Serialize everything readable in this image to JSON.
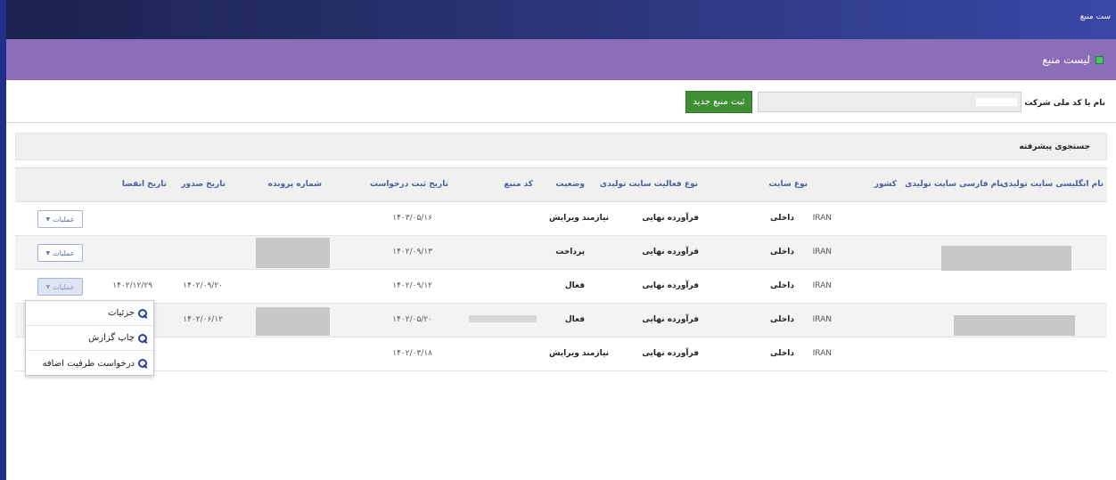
{
  "header": {
    "breadcrumb": "ست منبع"
  },
  "title_bar": {
    "title": "لیست منبع",
    "colors": {
      "title_bg": "#8c6db8",
      "top_bg": "#1b2250"
    }
  },
  "search": {
    "label": "نام یا کد ملی شرکت",
    "value": "",
    "placeholder": ""
  },
  "toolbar": {
    "new_button": "ثبت منبع جدید",
    "new_button_color": "#3f8f35"
  },
  "advanced_search": {
    "label": "جستجوی پیشرفته"
  },
  "table": {
    "columns": [
      "نام انگلیسی سایت تولیدی",
      "نام فارسی سایت تولیدی",
      "کشور",
      "نوع سایت",
      "نوع فعالیت سایت تولیدی",
      "وضعیت",
      "کد منبع",
      "تاریخ ثبت درخواست",
      "شماره پرونده",
      "تاریخ صدور",
      "تاریخ انقضا"
    ],
    "rows": [
      {
        "country": "IRAN",
        "site_type": "داخلی",
        "activity": "فرآورده نهایی",
        "status": "نیازمند ویرایش",
        "reg_date": "۱۴۰۳/۰۵/۱۶",
        "issue_date": "",
        "expiry_date": "",
        "ops": "عملیات"
      },
      {
        "country": "IRAN",
        "site_type": "داخلی",
        "activity": "فرآورده نهایی",
        "status": "پرداخت",
        "reg_date": "۱۴۰۲/۰۹/۱۳",
        "issue_date": "",
        "expiry_date": "",
        "ops": "عملیات"
      },
      {
        "country": "IRAN",
        "site_type": "داخلی",
        "activity": "فرآورده نهایی",
        "status": "فعال",
        "reg_date": "۱۴۰۲/۰۹/۱۲",
        "issue_date": "۱۴۰۲/۰۹/۲۰",
        "expiry_date": "۱۴۰۲/۱۲/۲۹",
        "ops": "عملیات"
      },
      {
        "country": "IRAN",
        "site_type": "داخلی",
        "activity": "فرآورده نهایی",
        "status": "فعال",
        "reg_date": "۱۴۰۲/۰۵/۲۰",
        "issue_date": "۱۴۰۲/۰۶/۱۲",
        "expiry_date": "",
        "ops": ""
      },
      {
        "country": "IRAN",
        "site_type": "داخلی",
        "activity": "فرآورده نهایی",
        "status": "نیازمند ویرایش",
        "reg_date": "۱۴۰۲/۰۳/۱۸",
        "issue_date": "",
        "expiry_date": "",
        "ops": ""
      }
    ]
  },
  "ops_menu": {
    "items": [
      "جزئیات",
      "چاپ گزارش",
      "درخواست ظرفیت اضافه"
    ],
    "icon": "magnifier-icon"
  }
}
